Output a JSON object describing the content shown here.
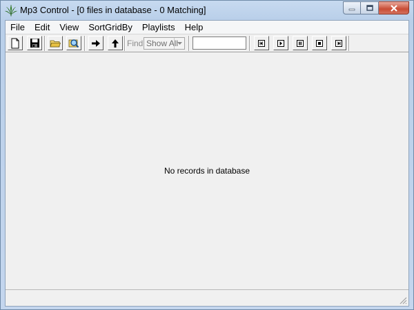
{
  "window": {
    "title": "Mp3 Control - [0 files in database - 0 Matching]",
    "icon": "cannabis-leaf-icon",
    "accent": "#b9cfe9",
    "close_color": "#c94c35"
  },
  "menu": {
    "items": [
      "File",
      "Edit",
      "View",
      "SortGridBy",
      "Playlists",
      "Help"
    ]
  },
  "toolbar": {
    "buttons": [
      {
        "name": "new-file-button",
        "icon": "new-document-icon"
      },
      {
        "name": "save-button",
        "icon": "floppy-disk-icon"
      },
      {
        "name": "open-folder-button",
        "icon": "folder-open-icon"
      },
      {
        "name": "search-files-button",
        "icon": "magnifier-icon"
      },
      {
        "name": "forward-button",
        "icon": "arrow-right-icon"
      },
      {
        "name": "up-button",
        "icon": "arrow-up-icon"
      }
    ],
    "find_label": "Find",
    "filter_select": {
      "value": "Show All"
    },
    "search_value": "",
    "playback": [
      {
        "name": "previous-button",
        "icon": "skip-back-icon"
      },
      {
        "name": "play-button",
        "icon": "play-icon"
      },
      {
        "name": "pause-button",
        "icon": "pause-icon"
      },
      {
        "name": "stop-button",
        "icon": "stop-icon"
      },
      {
        "name": "next-button",
        "icon": "skip-forward-icon"
      }
    ]
  },
  "grid": {
    "empty_message": "No records in database"
  }
}
